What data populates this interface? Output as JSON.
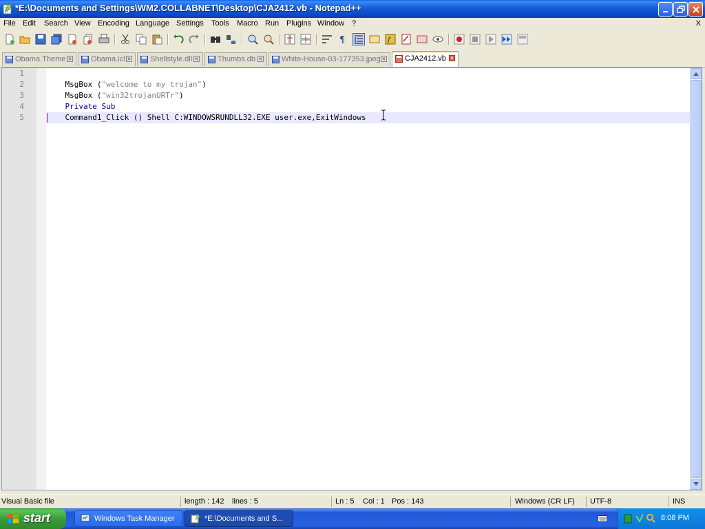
{
  "window": {
    "title": "*E:\\Documents and Settings\\WM2.COLLABNET\\Desktop\\CJA2412.vb - Notepad++"
  },
  "menu": {
    "items": [
      "File",
      "Edit",
      "Search",
      "View",
      "Encoding",
      "Language",
      "Settings",
      "Tools",
      "Macro",
      "Run",
      "Plugins",
      "Window",
      "?"
    ],
    "close_label": "X"
  },
  "toolbar": {
    "icons": [
      "new-file-icon",
      "open-file-icon",
      "save-icon",
      "save-all-icon",
      "close-file-icon",
      "close-all-icon",
      "print-icon",
      "cut-icon",
      "copy-icon",
      "paste-icon",
      "undo-icon",
      "redo-icon",
      "find-icon",
      "replace-icon",
      "zoom-in-icon",
      "zoom-out-icon",
      "sync-vertical-icon",
      "sync-horizontal-icon",
      "word-wrap-icon",
      "show-all-chars-icon",
      "indent-guide-icon",
      "user-lang-icon",
      "function-list-icon",
      "doc-map-icon",
      "monitor-icon",
      "preview-icon",
      "record-macro-icon",
      "stop-macro-icon",
      "play-macro-icon",
      "run-macro-multiple-icon",
      "save-macro-icon"
    ]
  },
  "tabs": [
    {
      "label": "Obama.Theme",
      "active": false
    },
    {
      "label": "Obama.icl",
      "active": false
    },
    {
      "label": "Shellstyle.dll",
      "active": false
    },
    {
      "label": "Thumbs.db",
      "active": false
    },
    {
      "label": "White-House-03-177353.jpeg",
      "active": false
    },
    {
      "label": "CJA2412.vb",
      "active": true
    }
  ],
  "editor": {
    "line_numbers": [
      "1",
      "2",
      "3",
      "4",
      "5"
    ],
    "lines": [
      [
        {
          "text": "MsgBox (",
          "cls": ""
        },
        {
          "text": "\"welcome to my trojan\"",
          "cls": "str"
        },
        {
          "text": ")",
          "cls": ""
        }
      ],
      [
        {
          "text": "MsgBox (",
          "cls": ""
        },
        {
          "text": "\"win32trojanURTr\"",
          "cls": "str"
        },
        {
          "text": ")",
          "cls": ""
        }
      ],
      [
        {
          "text": "Private Sub",
          "cls": "kw"
        }
      ],
      [
        {
          "text": "Command1_Click () Shell C:WINDOWSRUNDLL32.EXE user.exe,ExitWindows",
          "cls": ""
        }
      ],
      []
    ],
    "current_line": 5
  },
  "status": {
    "file_type": "Visual Basic file",
    "length": "length : 142",
    "lines": "lines : 5",
    "ln": "Ln : 5",
    "col": "Col : 1",
    "pos": "Pos : 143",
    "eol": "Windows (CR LF)",
    "encoding": "UTF-8",
    "mode": "INS"
  },
  "taskbar": {
    "start_label": "start",
    "tasks": [
      {
        "label": "Windows Task Manager",
        "active": false
      },
      {
        "label": "*E:\\Documents and S...",
        "active": true
      }
    ],
    "clock": "8:08 PM"
  },
  "colors": {
    "title_bar": "#0a5fe8",
    "keyword": "#00008b",
    "string": "#808080",
    "active_tab_accent": "#fa9a2a",
    "current_line_bg": "#e8e8ff"
  }
}
